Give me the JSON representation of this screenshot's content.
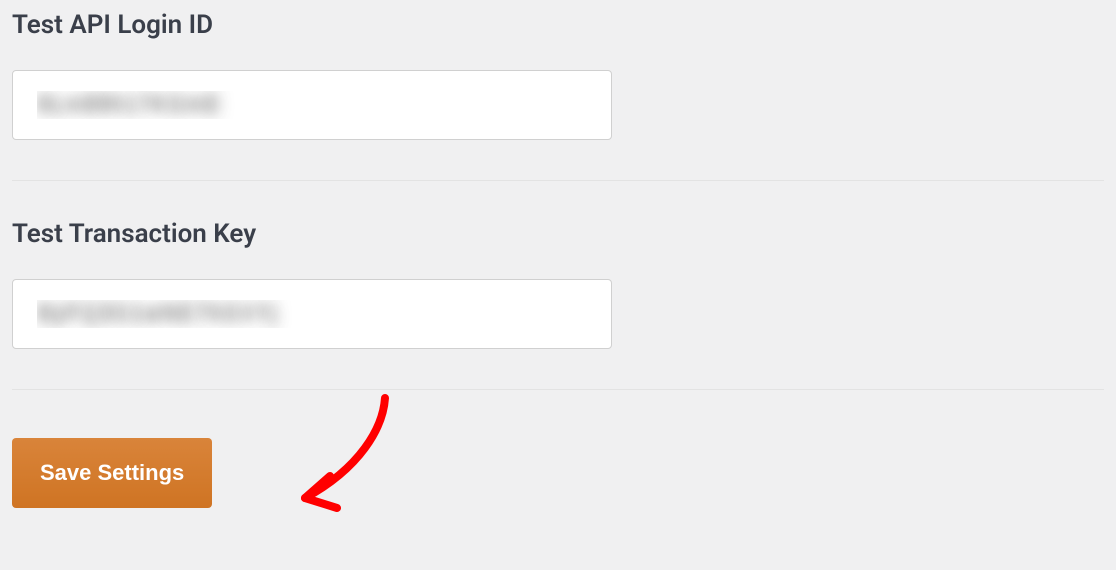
{
  "fields": {
    "api_login": {
      "label": "Test API Login ID",
      "value": "8Lm89h17KGmE"
    },
    "transaction_key": {
      "label": "Test Transaction Key",
      "value": "ByFQ3G1wNE7hGVYj"
    }
  },
  "actions": {
    "save_label": "Save Settings"
  },
  "colors": {
    "button_bg": "#d37b28",
    "annotation": "#ff0000"
  }
}
